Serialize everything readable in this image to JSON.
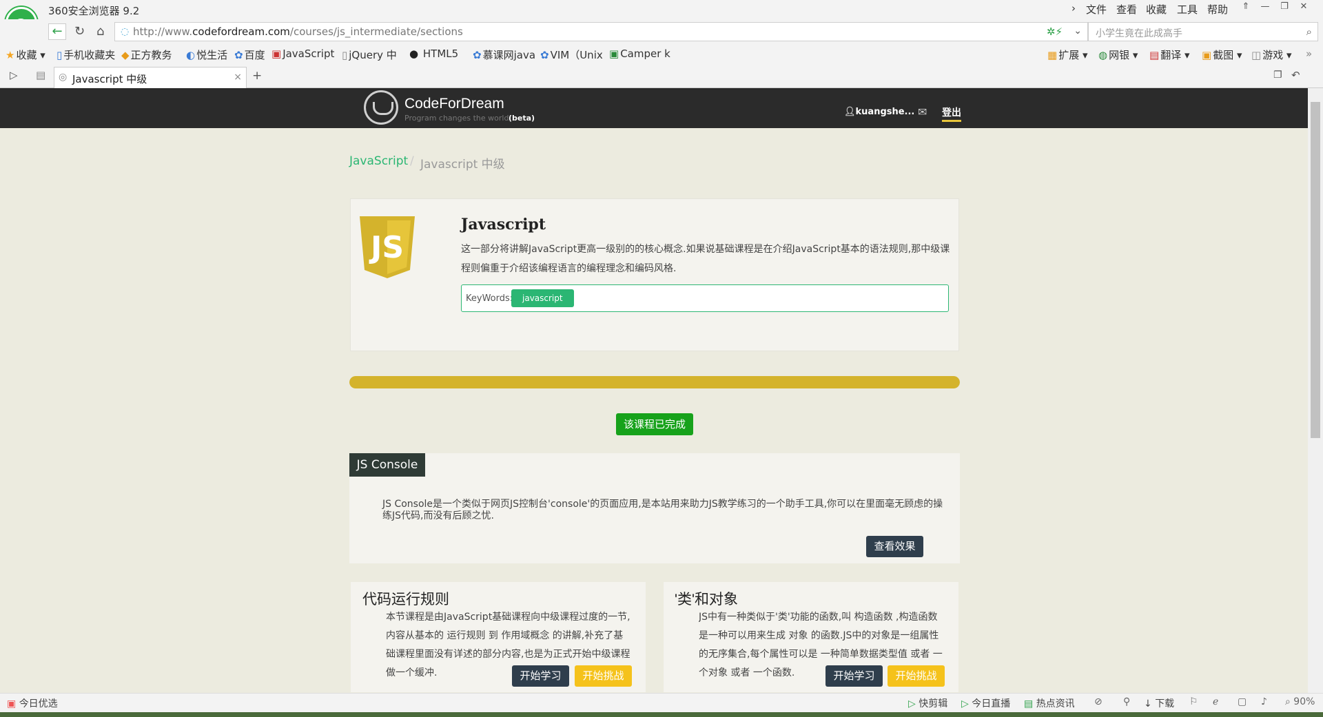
{
  "browser": {
    "app_title": "360安全浏览器 9.2",
    "menu": [
      "文件",
      "查看",
      "收藏",
      "工具",
      "帮助"
    ],
    "url_prefix": "http://www.",
    "url_domain": "codefordream.com",
    "url_path": "/courses/js_intermediate/sections",
    "search_placeholder": "小学生竟在此成高手",
    "bookmarks": [
      "收藏",
      "手机收藏夹",
      "正方教务",
      "悦生活",
      "百度",
      "JavaScript",
      "jQuery 中",
      "HTML5",
      "慕课网java",
      "VIM（Unix",
      "Camper k"
    ],
    "toolbar_right": [
      "扩展",
      "网银",
      "翻译",
      "截图",
      "游戏"
    ],
    "tab_title": "Javascript 中级",
    "new_tab": "+"
  },
  "site": {
    "brand": "CodeForDream",
    "tagline": "Program changes the world",
    "beta": "(beta)",
    "user": "kuangshe...",
    "logout": "登出"
  },
  "breadcrumb": {
    "root": "JavaScript",
    "sep": "/",
    "current": "Javascript 中级"
  },
  "course": {
    "logo_text": "JS",
    "title": "Javascript",
    "description": "这一部分将讲解JavaScript更高一级别的的核心概念.如果说基础课程是在介绍JavaScript基本的语法规则,那中级课程则偏重于介绍该编程语言的编程理念和编码风格.",
    "keywords_label": "KeyWords:",
    "keyword": "javascript",
    "progress": 1.0,
    "done_label": "该课程已完成"
  },
  "console": {
    "title": "JS Console",
    "description": "JS Console是一个类似于网页JS控制台'console'的页面应用,是本站用来助力JS教学练习的一个助手工具,你可以在里面毫无顾虑的操练JS代码,而没有后顾之忧.",
    "button": "查看效果"
  },
  "sections": [
    {
      "title": "代码运行规则",
      "description": "本节课程是由JavaScript基础课程向中级课程过度的一节,内容从基本的 运行规则 到 作用域概念 的讲解,补充了基础课程里面没有详述的部分内容,也是为正式开始中级课程做一个缓冲.",
      "learn": "开始学习",
      "challenge": "开始挑战"
    },
    {
      "title": "'类'和对象",
      "description": "JS中有一种类似于'类'功能的函数,叫 构造函数 ,构造函数是一种可以用来生成 对象 的函数.JS中的对象是一组属性的无序集合,每个属性可以是 一种简单数据类型值 或者 一个对象 或者 一个函数.",
      "learn": "开始学习",
      "challenge": "开始挑战"
    }
  ],
  "status": {
    "left": "今日优选",
    "items": [
      "快剪辑",
      "今日直播",
      "热点资讯",
      "下载"
    ],
    "zoom": "90%"
  },
  "colors": {
    "header_bg": "#2b2b2b",
    "accent_green": "#2bb673",
    "progress_yellow": "#d4b32c",
    "done_green": "#17a21b",
    "btn_dark": "#2f3e4c",
    "btn_yellow": "#f5c21b"
  }
}
